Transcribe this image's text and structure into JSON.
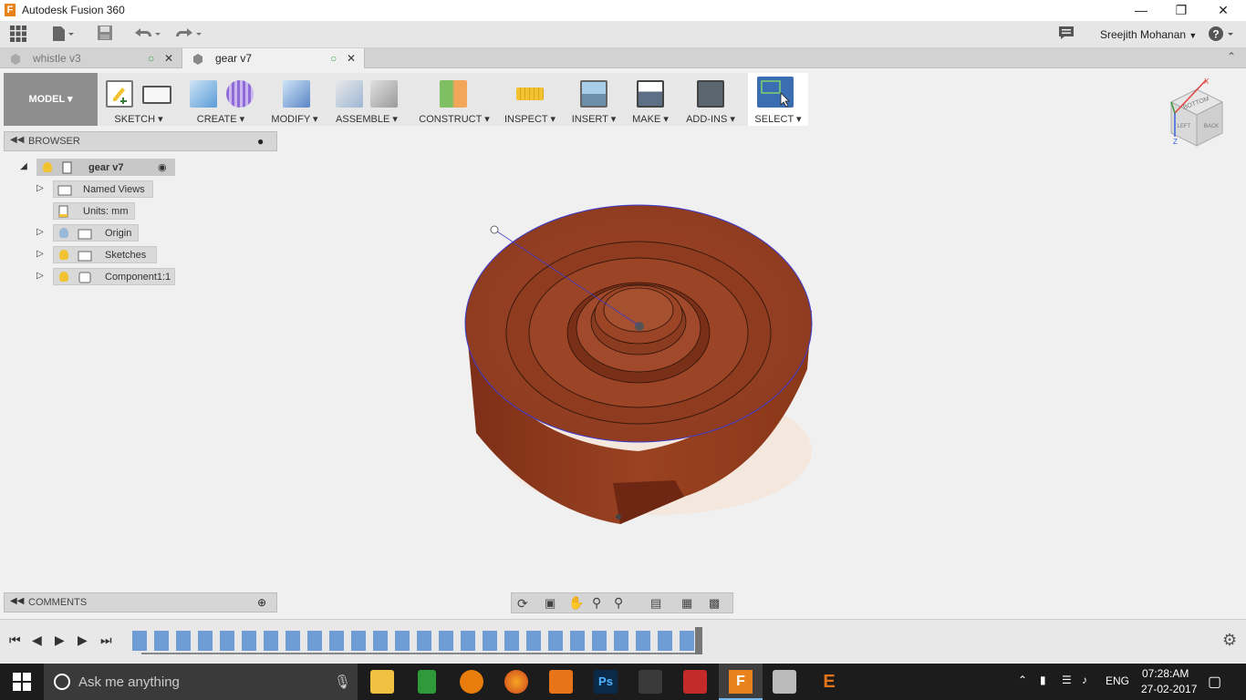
{
  "window": {
    "title": "Autodesk Fusion 360",
    "app_icon": "F"
  },
  "user": {
    "name": "Sreejith Mohanan"
  },
  "tabs": [
    {
      "label": "whistle v3"
    },
    {
      "label": "gear v7"
    }
  ],
  "workspace": {
    "label": "MODEL"
  },
  "toolbar": {
    "groups": [
      {
        "label": "SKETCH"
      },
      {
        "label": "CREATE"
      },
      {
        "label": "MODIFY"
      },
      {
        "label": "ASSEMBLE"
      },
      {
        "label": "CONSTRUCT"
      },
      {
        "label": "INSPECT"
      },
      {
        "label": "INSERT"
      },
      {
        "label": "MAKE"
      },
      {
        "label": "ADD-INS"
      },
      {
        "label": "SELECT"
      }
    ]
  },
  "browser": {
    "title": "BROWSER",
    "root": "gear v7",
    "items": [
      {
        "label": "Named Views"
      },
      {
        "label": "Units: mm"
      },
      {
        "label": "Origin"
      },
      {
        "label": "Sketches"
      },
      {
        "label": "Component1:1"
      }
    ]
  },
  "comments": {
    "title": "COMMENTS"
  },
  "viewcube": {
    "faces": [
      "BOTTOM",
      "BACK",
      "LEFT"
    ]
  },
  "taskbar": {
    "search_placeholder": "Ask me anything",
    "language": "ENG",
    "time": "07:28:AM",
    "date": "27-02-2017"
  },
  "colors": {
    "model": "#8b3a1f",
    "accent": "#0078d7"
  }
}
